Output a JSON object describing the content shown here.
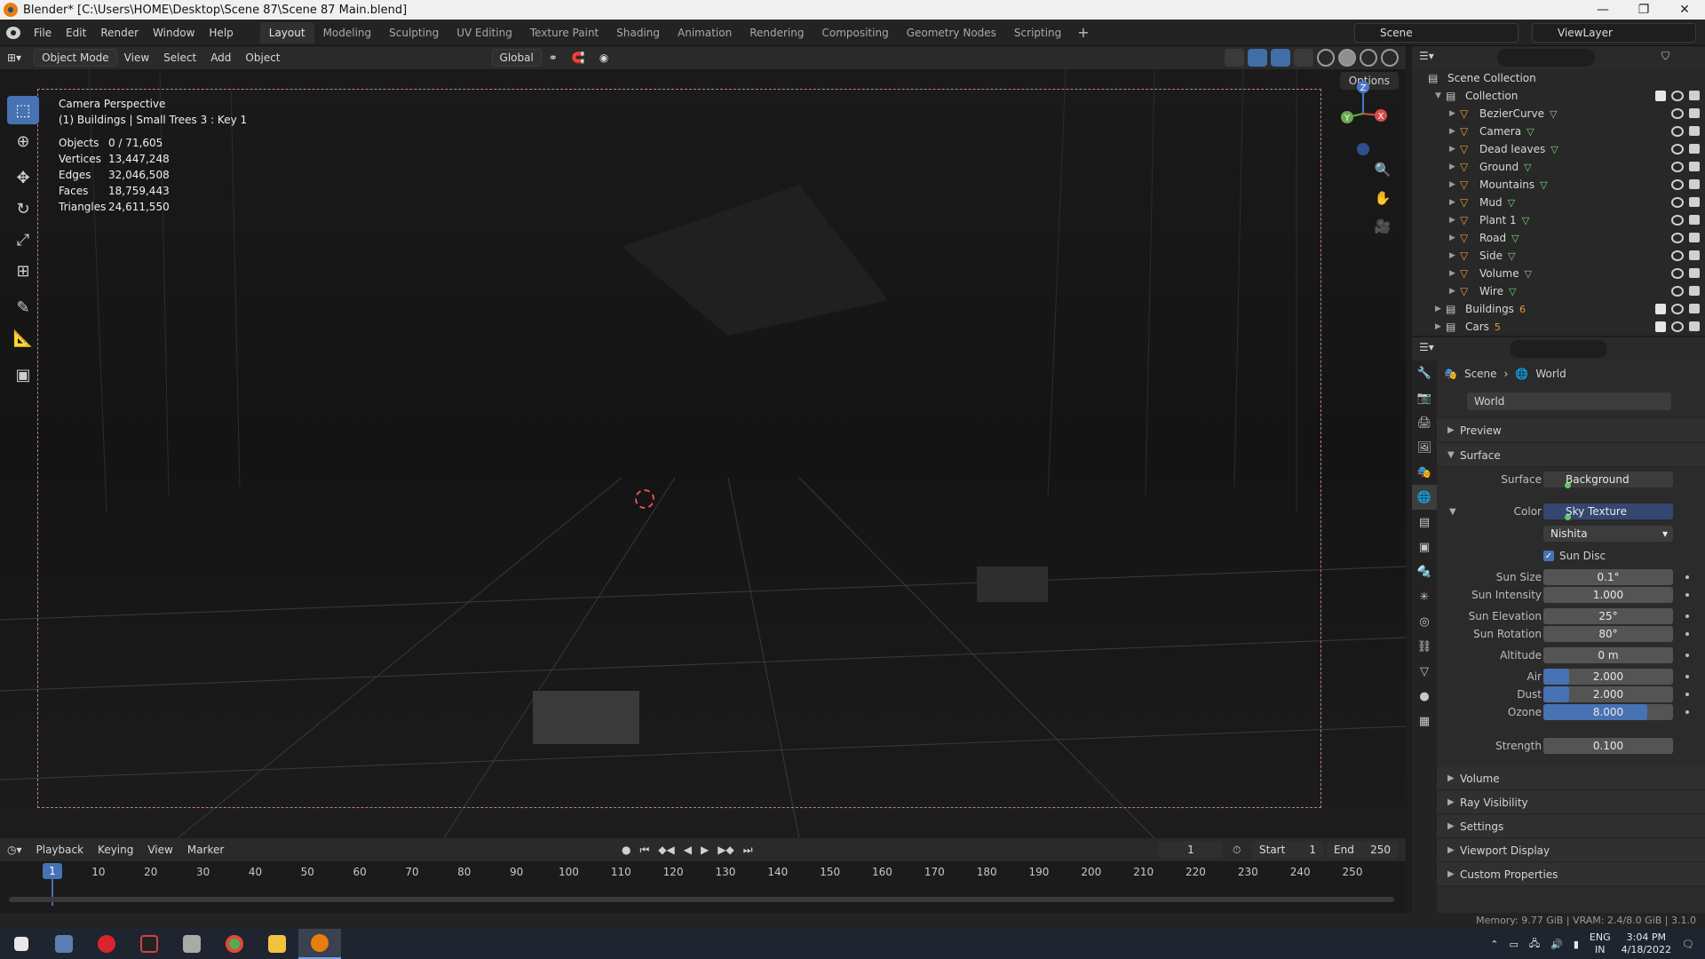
{
  "window": {
    "title": "Blender* [C:\\Users\\HOME\\Desktop\\Scene 87\\Scene 87 Main.blend]",
    "minimize": "—",
    "maximize": "❐",
    "close": "✕"
  },
  "menu": [
    "File",
    "Edit",
    "Render",
    "Window",
    "Help"
  ],
  "workspaces": [
    "Layout",
    "Modeling",
    "Sculpting",
    "UV Editing",
    "Texture Paint",
    "Shading",
    "Animation",
    "Rendering",
    "Compositing",
    "Geometry Nodes",
    "Scripting"
  ],
  "workspace_add": "+",
  "scene_name": "Scene",
  "view_layer": "ViewLayer",
  "viewport_header": {
    "mode": "Object Mode",
    "menus": [
      "View",
      "Select",
      "Add",
      "Object"
    ],
    "transform_orientation": "Global",
    "options": "Options"
  },
  "viewport_overlay": {
    "perspective": "Camera Perspective",
    "active": "(1) Buildings | Small Trees 3 : Key 1",
    "stats": [
      {
        "label": "Objects",
        "value": "0 / 71,605"
      },
      {
        "label": "Vertices",
        "value": "13,447,248"
      },
      {
        "label": "Edges",
        "value": "32,046,508"
      },
      {
        "label": "Faces",
        "value": "18,759,443"
      },
      {
        "label": "Triangles",
        "value": "24,611,550"
      }
    ]
  },
  "gizmo": {
    "z": "Z",
    "y": "Y",
    "x": "X"
  },
  "timeline": {
    "menus": [
      "Playback",
      "Keying",
      "View",
      "Marker"
    ],
    "current_frame": "1",
    "start_label": "Start",
    "start": "1",
    "end_label": "End",
    "end": "250",
    "ticks": [
      "1",
      "10",
      "20",
      "30",
      "40",
      "50",
      "60",
      "70",
      "80",
      "90",
      "100",
      "110",
      "120",
      "130",
      "140",
      "150",
      "160",
      "170",
      "180",
      "190",
      "200",
      "210",
      "220",
      "230",
      "240",
      "250"
    ]
  },
  "status": {
    "memory": "Memory: 9.77 GiB | VRAM: 2.4/8.0 GiB | 3.1.0"
  },
  "outliner": {
    "root": "Scene Collection",
    "collection": "Collection",
    "items": [
      "BezierCurve",
      "Camera",
      "Dead leaves",
      "Ground",
      "Mountains",
      "Mud",
      "Plant 1",
      "Road",
      "Side",
      "Volume",
      "Wire"
    ],
    "sub_collections": [
      {
        "name": "Buildings",
        "badge": "6"
      },
      {
        "name": "Cars",
        "badge": "5"
      }
    ]
  },
  "properties": {
    "breadcrumb": [
      "Scene",
      "World"
    ],
    "world_name": "World",
    "panels": {
      "preview": "Preview",
      "surface": "Surface",
      "volume": "Volume",
      "ray_visibility": "Ray Visibility",
      "settings": "Settings",
      "viewport_display": "Viewport Display",
      "custom_properties": "Custom Properties"
    },
    "surface": {
      "label": "Surface",
      "value": "Background"
    },
    "color": {
      "label": "Color",
      "value": "Sky Texture"
    },
    "sky_type": "Nishita",
    "sun_disc": "Sun Disc",
    "fields": [
      {
        "label": "Sun Size",
        "value": "0.1°"
      },
      {
        "label": "Sun Intensity",
        "value": "1.000"
      },
      {
        "label": "Sun Elevation",
        "value": "25°"
      },
      {
        "label": "Sun Rotation",
        "value": "80°"
      },
      {
        "label": "Altitude",
        "value": "0 m"
      },
      {
        "label": "Air",
        "value": "2.000",
        "fill": 0.2
      },
      {
        "label": "Dust",
        "value": "2.000",
        "fill": 0.2
      },
      {
        "label": "Ozone",
        "value": "8.000",
        "fill": 0.8
      }
    ],
    "strength": {
      "label": "Strength",
      "value": "0.100"
    }
  },
  "taskbar": {
    "lang": "ENG",
    "region": "IN",
    "time": "3:04 PM",
    "date": "4/18/2022"
  }
}
